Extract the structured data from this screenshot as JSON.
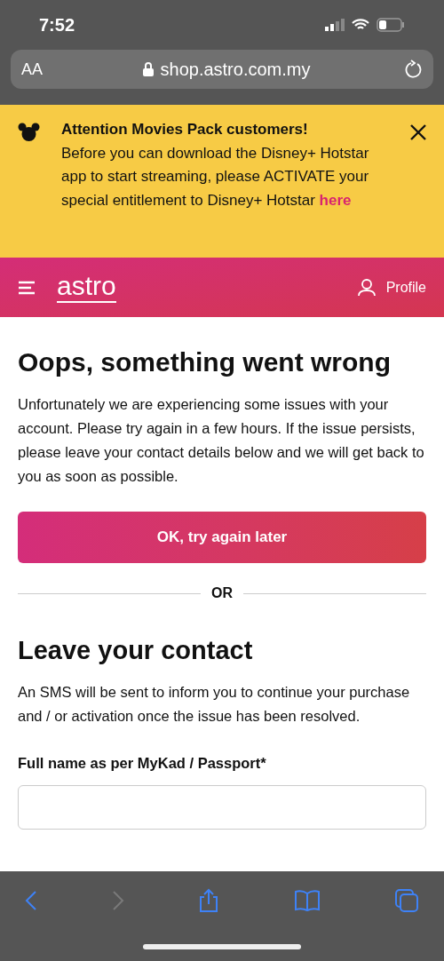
{
  "status_bar": {
    "time": "7:52"
  },
  "address_bar": {
    "text_size": "AA",
    "url": "shop.astro.com.my"
  },
  "banner": {
    "title": "Attention Movies Pack customers!",
    "message": "Before you can download the Disney+ Hotstar app to start streaming, please ACTIVATE your special entitlement to Disney+ Hotstar",
    "link": "here"
  },
  "header": {
    "logo": "astro",
    "profile": "Profile"
  },
  "error": {
    "title": "Oops, something went wrong",
    "message": "Unfortunately we are experiencing some issues with your account. Please try again in a few hours. If the issue persists, please leave your contact details below and we will get back to you as soon as possible.",
    "button": "OK, try again later"
  },
  "divider": "OR",
  "contact": {
    "title": "Leave your contact",
    "message": "An SMS will be sent to inform you to continue your purchase and / or activation once the issue has been resolved.",
    "field_label": "Full name as per MyKad / Passport*"
  },
  "toolbar": {
    "back_disabled": false,
    "forward_disabled": true
  }
}
